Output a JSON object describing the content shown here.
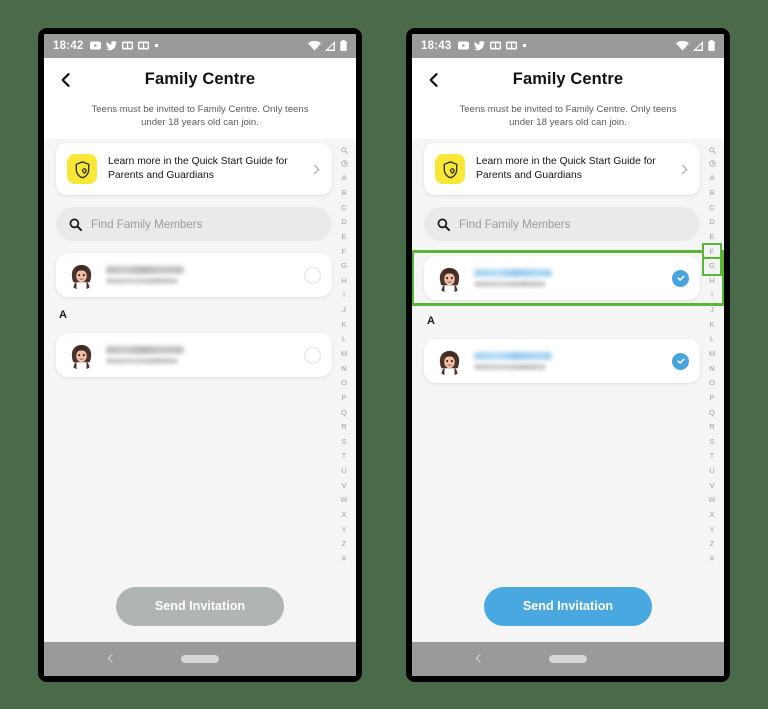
{
  "background_color": "#4a6b4a",
  "accent": {
    "snap_yellow": "#f7e838",
    "select_blue": "#4aa3dd",
    "cta_blue": "#4aa8e0",
    "cta_disabled": "#b0b4b3",
    "highlight_green": "#5cb536"
  },
  "phones": [
    {
      "id": "left",
      "status_bar": {
        "time": "18:42",
        "left_icons": [
          "youtube-icon",
          "twitter-icon",
          "screenshot-icon",
          "screenshot-icon",
          "dot-icon"
        ],
        "right_icons": [
          "wifi-icon",
          "signal-icon",
          "battery-icon"
        ]
      },
      "header": {
        "back_label": "back-chevron-icon",
        "title": "Family Centre"
      },
      "subtitle": "Teens must be invited to Family Centre. Only teens under 18 years old can join.",
      "promo": {
        "icon": "snapchat-family-shield-icon",
        "text": "Learn more in the Quick Start Guide for Parents and Guardians",
        "chevron": "chevron-right-icon"
      },
      "search": {
        "icon": "search-icon",
        "placeholder": "Find Family Members",
        "value": ""
      },
      "contacts": [
        {
          "name_redacted": true,
          "handle_redacted": true,
          "selected": false,
          "highlighted": false,
          "avatar": "bitmoji-avatar"
        }
      ],
      "section_letter": "A",
      "contacts_section": [
        {
          "name_redacted": true,
          "handle_redacted": true,
          "selected": false,
          "highlighted": false,
          "avatar": "bitmoji-avatar"
        }
      ],
      "index": [
        "search-icon",
        "recent-icon",
        "A",
        "B",
        "C",
        "D",
        "E",
        "F",
        "G",
        "H",
        "I",
        "J",
        "K",
        "L",
        "M",
        "N",
        "O",
        "P",
        "Q",
        "R",
        "S",
        "T",
        "U",
        "V",
        "W",
        "X",
        "Y",
        "Z",
        "#"
      ],
      "index_highlight": null,
      "cta": {
        "label": "Send Invitation",
        "enabled": false
      },
      "navbar": {
        "back": "nav-back-icon",
        "home": "nav-home-pill"
      }
    },
    {
      "id": "right",
      "status_bar": {
        "time": "18:43",
        "left_icons": [
          "youtube-icon",
          "twitter-icon",
          "screenshot-icon",
          "screenshot-icon",
          "dot-icon"
        ],
        "right_icons": [
          "wifi-icon",
          "signal-icon",
          "battery-icon"
        ]
      },
      "header": {
        "back_label": "back-chevron-icon",
        "title": "Family Centre"
      },
      "subtitle": "Teens must be invited to Family Centre. Only teens under 18 years old can join.",
      "promo": {
        "icon": "snapchat-family-shield-icon",
        "text": "Learn more in the Quick Start Guide for Parents and Guardians",
        "chevron": "chevron-right-icon"
      },
      "search": {
        "icon": "search-icon",
        "placeholder": "Find Family Members",
        "value": ""
      },
      "contacts": [
        {
          "name_redacted": true,
          "handle_redacted": true,
          "selected": true,
          "highlighted": true,
          "avatar": "bitmoji-avatar"
        }
      ],
      "section_letter": "A",
      "contacts_section": [
        {
          "name_redacted": true,
          "handle_redacted": true,
          "selected": true,
          "highlighted": false,
          "avatar": "bitmoji-avatar"
        }
      ],
      "index": [
        "search-icon",
        "recent-icon",
        "A",
        "B",
        "C",
        "D",
        "E",
        "F",
        "G",
        "H",
        "I",
        "J",
        "K",
        "L",
        "M",
        "N",
        "O",
        "P",
        "Q",
        "R",
        "S",
        "T",
        "U",
        "V",
        "W",
        "X",
        "Y",
        "Z",
        "#"
      ],
      "index_highlight": [
        "F",
        "G"
      ],
      "cta": {
        "label": "Send Invitation",
        "enabled": true
      },
      "navbar": {
        "back": "nav-back-icon",
        "home": "nav-home-pill"
      }
    }
  ]
}
